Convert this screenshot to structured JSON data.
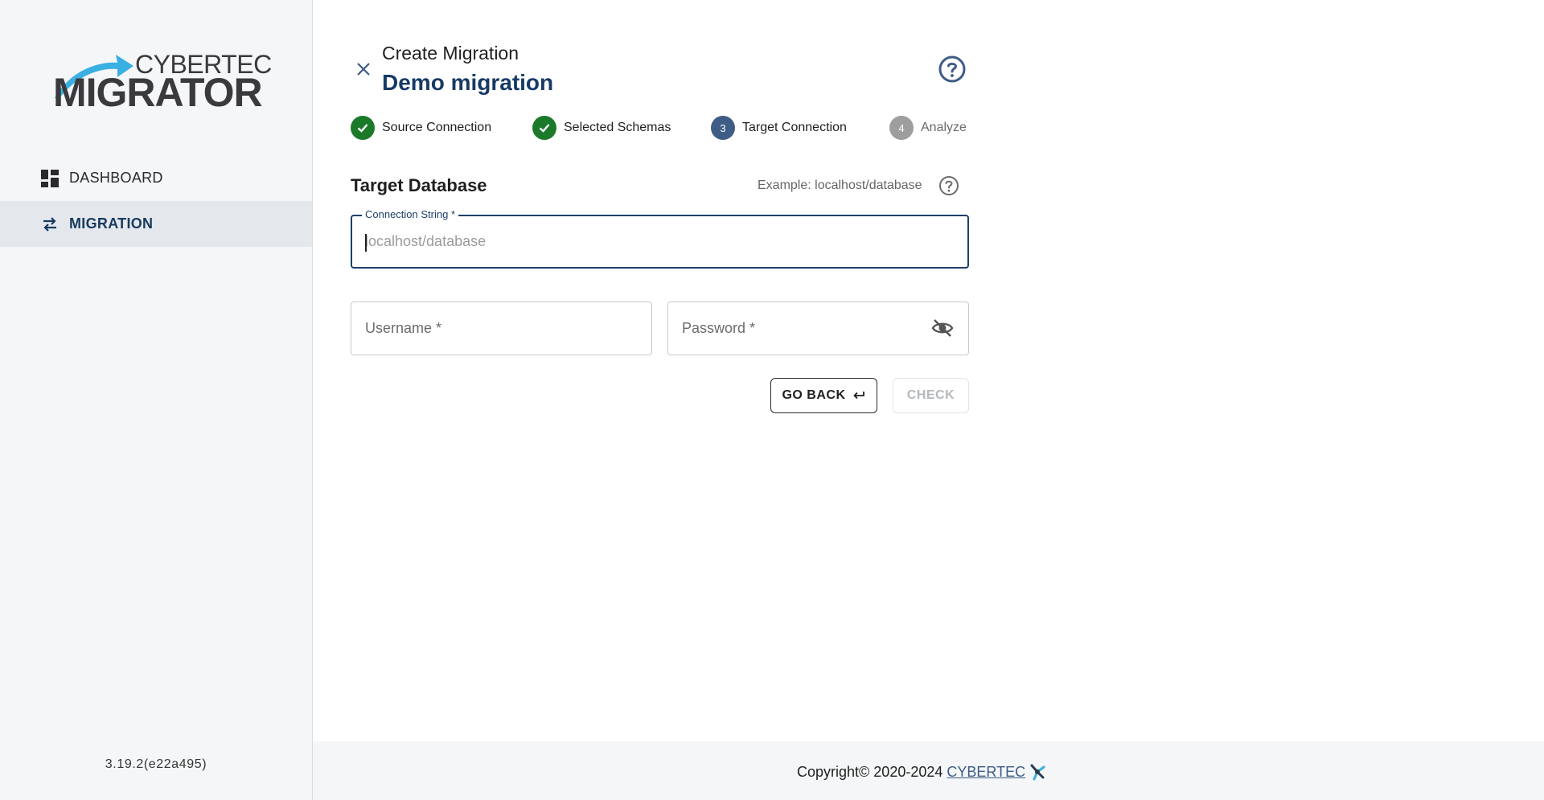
{
  "sidebar": {
    "logo": {
      "top": "CYBERTEC",
      "bottom": "MIGRATOR"
    },
    "items": [
      {
        "label": "DASHBOARD",
        "icon": "dashboard-icon",
        "active": false
      },
      {
        "label": "MIGRATION",
        "icon": "swap-arrows-icon",
        "active": true
      }
    ],
    "version": "3.19.2(e22a495)"
  },
  "header": {
    "title": "Create Migration",
    "subtitle": "Demo migration"
  },
  "stepper": [
    {
      "label": "Source Connection",
      "status": "done"
    },
    {
      "label": "Selected Schemas",
      "status": "done"
    },
    {
      "label": "Target Connection",
      "status": "current",
      "number": "3"
    },
    {
      "label": "Analyze",
      "status": "pending",
      "number": "4"
    }
  ],
  "form": {
    "section_title": "Target Database",
    "example": "Example: localhost/database",
    "connection_label": "Connection String *",
    "connection_placeholder": "localhost/database",
    "connection_value": "",
    "username_label": "Username *",
    "password_label": "Password *"
  },
  "buttons": {
    "back": "GO BACK",
    "check": "CHECK"
  },
  "footer": {
    "copyright": "Copyright© 2020-2024",
    "link": "CYBERTEC"
  },
  "colors": {
    "accent": "#173a66",
    "done": "#1a7a2a",
    "current": "#3e5c86",
    "pending": "#9e9e9e"
  }
}
